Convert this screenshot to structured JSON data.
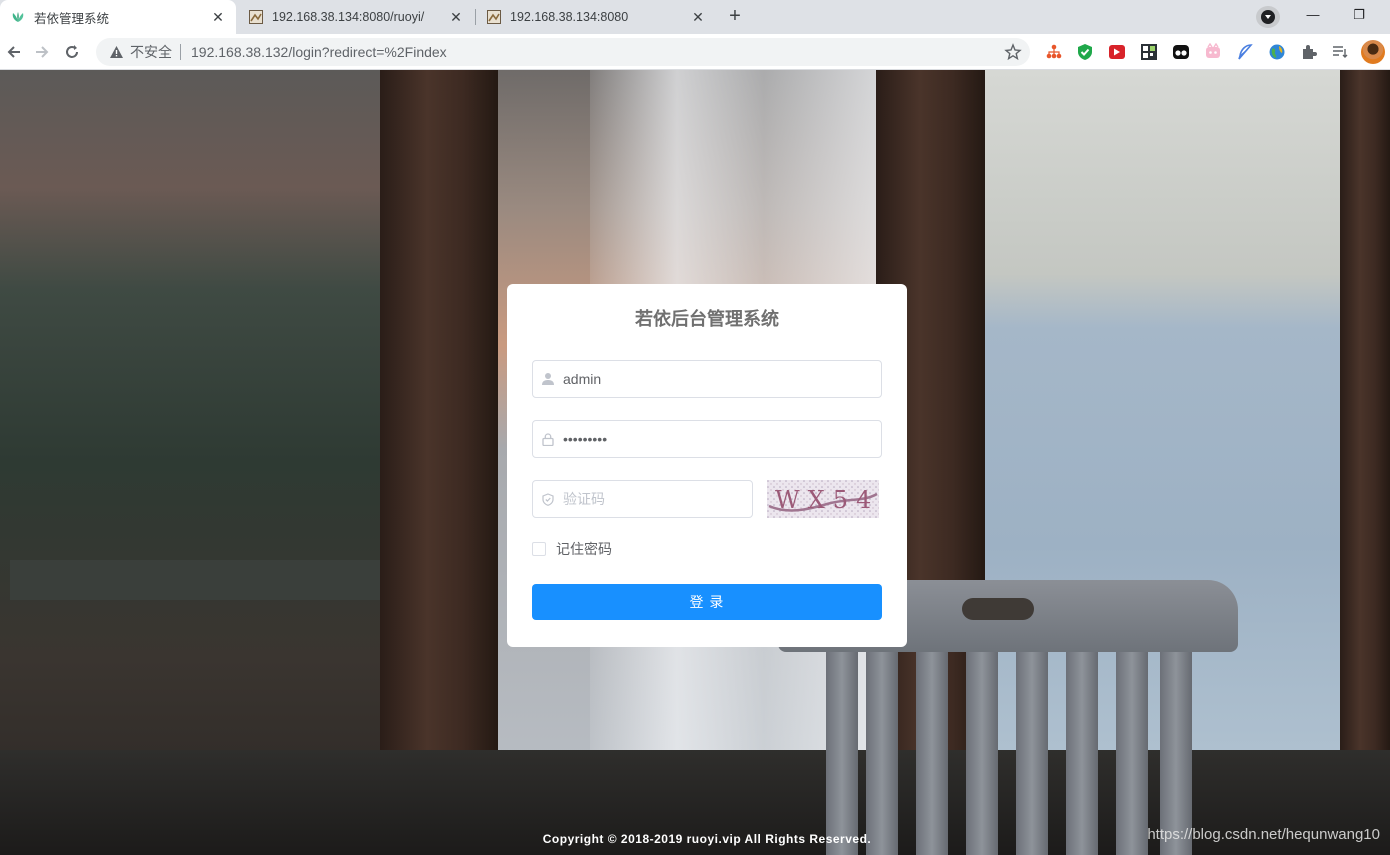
{
  "browser": {
    "tabs": [
      {
        "title": "若依管理系统",
        "active": true,
        "favicon": "leaf-logo-icon"
      },
      {
        "title": "192.168.38.134:8080/ruoyi/",
        "active": false,
        "favicon": "page-thumbnail-icon"
      },
      {
        "title": "192.168.38.134:8080",
        "active": false,
        "favicon": "page-thumbnail-icon"
      }
    ],
    "new_tab_label": "+",
    "window_controls": {
      "minimize": "—",
      "restore": "❐"
    },
    "address_bar": {
      "security_label": "不安全",
      "url": "192.168.38.132/login?redirect=%2Findex"
    }
  },
  "login": {
    "title": "若依后台管理系统",
    "username_value": "admin",
    "password_value": "•••••••••",
    "captcha_placeholder": "验证码",
    "captcha_text": "WX54",
    "remember_label": "记住密码",
    "submit_label": "登 录"
  },
  "footer": {
    "copyright": "Copyright © 2018-2019 ruoyi.vip All Rights Reserved."
  },
  "watermark": "https://blog.csdn.net/hequnwang10",
  "colors": {
    "primary": "#1890ff",
    "title": "#707070",
    "input_border": "#dcdfe6"
  }
}
